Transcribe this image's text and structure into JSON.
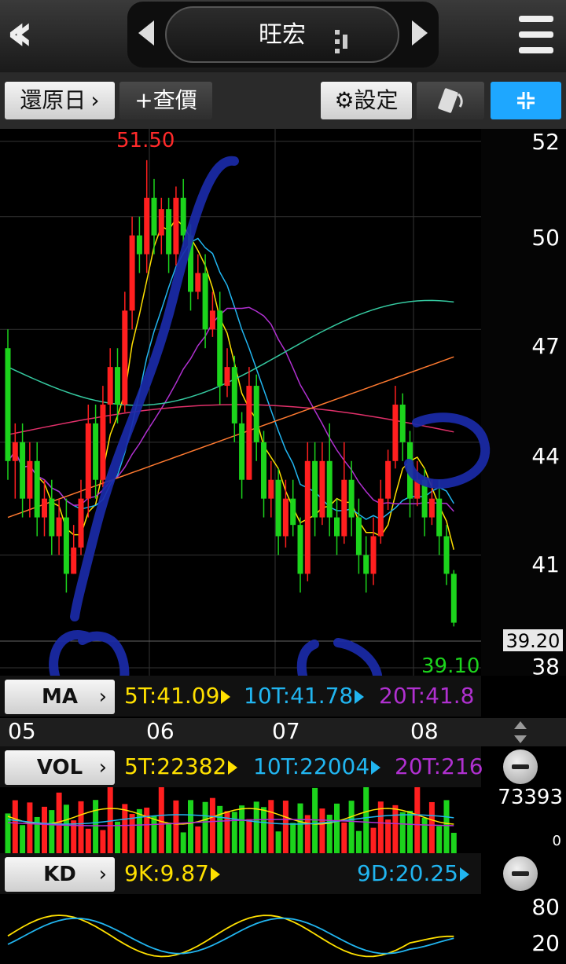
{
  "header": {
    "title": "旺宏"
  },
  "toolbar": {
    "restore_label": "還原日",
    "query_label": "+查價",
    "settings_label": "設定"
  },
  "price_axis": {
    "labels": [
      "52",
      "50",
      "47",
      "44",
      "41",
      "38"
    ],
    "current": "39.20"
  },
  "annotations": {
    "high": "51.50",
    "low": "39.10"
  },
  "ma_bar": {
    "label": "MA",
    "ma5": "5T:41.09",
    "ma10": "10T:41.78",
    "ma20": "20T:41.8"
  },
  "x_axis": {
    "labels": [
      "05",
      "06",
      "07",
      "08"
    ]
  },
  "vol_bar": {
    "label": "VOL",
    "v5": "5T:22382",
    "v10": "10T:22004",
    "v20": "20T:216",
    "max": "73393",
    "min": "0"
  },
  "kd_bar": {
    "label": "KD",
    "k": "9K:9.87",
    "d": "9D:20.25",
    "upper": "80",
    "lower": "20"
  },
  "colors": {
    "up": "#ff1f1f",
    "down": "#1cd41c",
    "ma5": "#ffe000",
    "ma10": "#21b5f0",
    "ma20": "#b030d0",
    "accent": "#1ea7ff"
  },
  "chart_data": {
    "type": "candlestick",
    "x_labels": [
      "05",
      "06",
      "07",
      "08"
    ],
    "ylim": [
      38,
      52
    ],
    "high": 51.5,
    "low": 39.1,
    "last": 39.2,
    "candles": [
      [
        46.5,
        43.5,
        47,
        43
      ],
      [
        43.5,
        44,
        44.5,
        42.5
      ],
      [
        44,
        42.5,
        44.5,
        42
      ],
      [
        42.5,
        43.5,
        44,
        42
      ],
      [
        43.5,
        42,
        44,
        41.5
      ],
      [
        42,
        42.5,
        43,
        41.5
      ],
      [
        42.5,
        41.5,
        43,
        41
      ],
      [
        41.5,
        42,
        42.5,
        41
      ],
      [
        42,
        40.5,
        42.5,
        40
      ],
      [
        40.5,
        41.2,
        41.8,
        40.5
      ],
      [
        41.2,
        42.5,
        43,
        41
      ],
      [
        42.5,
        44.5,
        45,
        42
      ],
      [
        44.5,
        43,
        45,
        42.5
      ],
      [
        43,
        45,
        45.5,
        42.8
      ],
      [
        45,
        46,
        46.5,
        44.5
      ],
      [
        46,
        45,
        46.5,
        44.5
      ],
      [
        45,
        47.5,
        48,
        44.8
      ],
      [
        47.5,
        49.5,
        50,
        47
      ],
      [
        49.5,
        49,
        50,
        48.5
      ],
      [
        49,
        50.5,
        51.5,
        48.5
      ],
      [
        50.5,
        49.5,
        51,
        49
      ],
      [
        49.5,
        50.2,
        50.5,
        49
      ],
      [
        50.2,
        49,
        50.5,
        48.5
      ],
      [
        49,
        50.5,
        50.8,
        48.7
      ],
      [
        50.5,
        49.5,
        51,
        49.2
      ],
      [
        49.5,
        48,
        49.8,
        47.5
      ],
      [
        48,
        48.5,
        49,
        47.8
      ],
      [
        48.5,
        47,
        49,
        46.5
      ],
      [
        47,
        47.5,
        48,
        46.8
      ],
      [
        47.5,
        45.5,
        48,
        45
      ],
      [
        45.5,
        46,
        46.5,
        45.2
      ],
      [
        46,
        44.5,
        46.3,
        44
      ],
      [
        44.5,
        43,
        44.8,
        42.5
      ],
      [
        43,
        45.5,
        46,
        43
      ],
      [
        45.5,
        44,
        45.8,
        43.5
      ],
      [
        44,
        42.5,
        44.3,
        42
      ],
      [
        42.5,
        43,
        43.5,
        42
      ],
      [
        43,
        41.5,
        43.3,
        41
      ],
      [
        41.5,
        42.5,
        43,
        41.2
      ],
      [
        42.5,
        41.8,
        43,
        41.5
      ],
      [
        41.8,
        40.5,
        42,
        40
      ],
      [
        40.5,
        43.5,
        44,
        40.3
      ],
      [
        43.5,
        42,
        44,
        41.5
      ],
      [
        42,
        43.5,
        44,
        41.8
      ],
      [
        43.5,
        42,
        44.5,
        41.5
      ],
      [
        42,
        41.5,
        42.5,
        41
      ],
      [
        41.5,
        43,
        44,
        41.3
      ],
      [
        43,
        42,
        43.5,
        41.5
      ],
      [
        42,
        41,
        42.5,
        40.5
      ],
      [
        41,
        40.5,
        41.5,
        40
      ],
      [
        40.5,
        41.5,
        42,
        40.2
      ],
      [
        41.5,
        42.5,
        43,
        41.3
      ],
      [
        42.5,
        43.5,
        43.8,
        42.2
      ],
      [
        43.5,
        45,
        45.5,
        43.3
      ],
      [
        45,
        44,
        45.3,
        43.5
      ],
      [
        44,
        42.5,
        44.3,
        42
      ],
      [
        42.5,
        43,
        43.5,
        42.3
      ],
      [
        43,
        42,
        43.3,
        41.5
      ],
      [
        42,
        42.5,
        43,
        41.8
      ],
      [
        42.5,
        41.5,
        43,
        41
      ],
      [
        41.5,
        40.5,
        41.8,
        40.2
      ],
      [
        40.5,
        39.2,
        40.6,
        39.1
      ]
    ],
    "series": [
      {
        "name": "5T",
        "last": 41.09
      },
      {
        "name": "10T",
        "last": 41.78
      },
      {
        "name": "20T",
        "last": 41.8
      }
    ],
    "volume_ylim": [
      0,
      73393
    ],
    "kd": {
      "k": 9.87,
      "d": 20.25,
      "levels": [
        80,
        20
      ]
    }
  }
}
